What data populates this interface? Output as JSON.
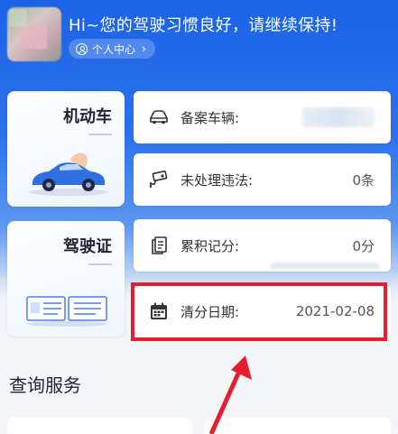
{
  "header": {
    "greeting": "Hi~您的驾驶习惯良好，请继续保持!",
    "personal_center": "个人中心",
    "chevron": "›"
  },
  "categories": [
    {
      "title": "机动车",
      "icon": "car-illustration"
    },
    {
      "title": "驾驶证",
      "icon": "license-illustration"
    }
  ],
  "info_rows": [
    {
      "label": "备案车辆:",
      "value": "",
      "icon": "car-icon"
    },
    {
      "label": "未处理违法:",
      "value": "0条",
      "icon": "camera-icon"
    },
    {
      "label": "累积记分:",
      "value": "0分",
      "icon": "document-icon"
    },
    {
      "label": "清分日期:",
      "value": "2021-02-08",
      "icon": "calendar-icon"
    }
  ],
  "section": {
    "title": "查询服务"
  },
  "colors": {
    "primary": "#1c63e6",
    "highlight": "#e61e2c"
  }
}
